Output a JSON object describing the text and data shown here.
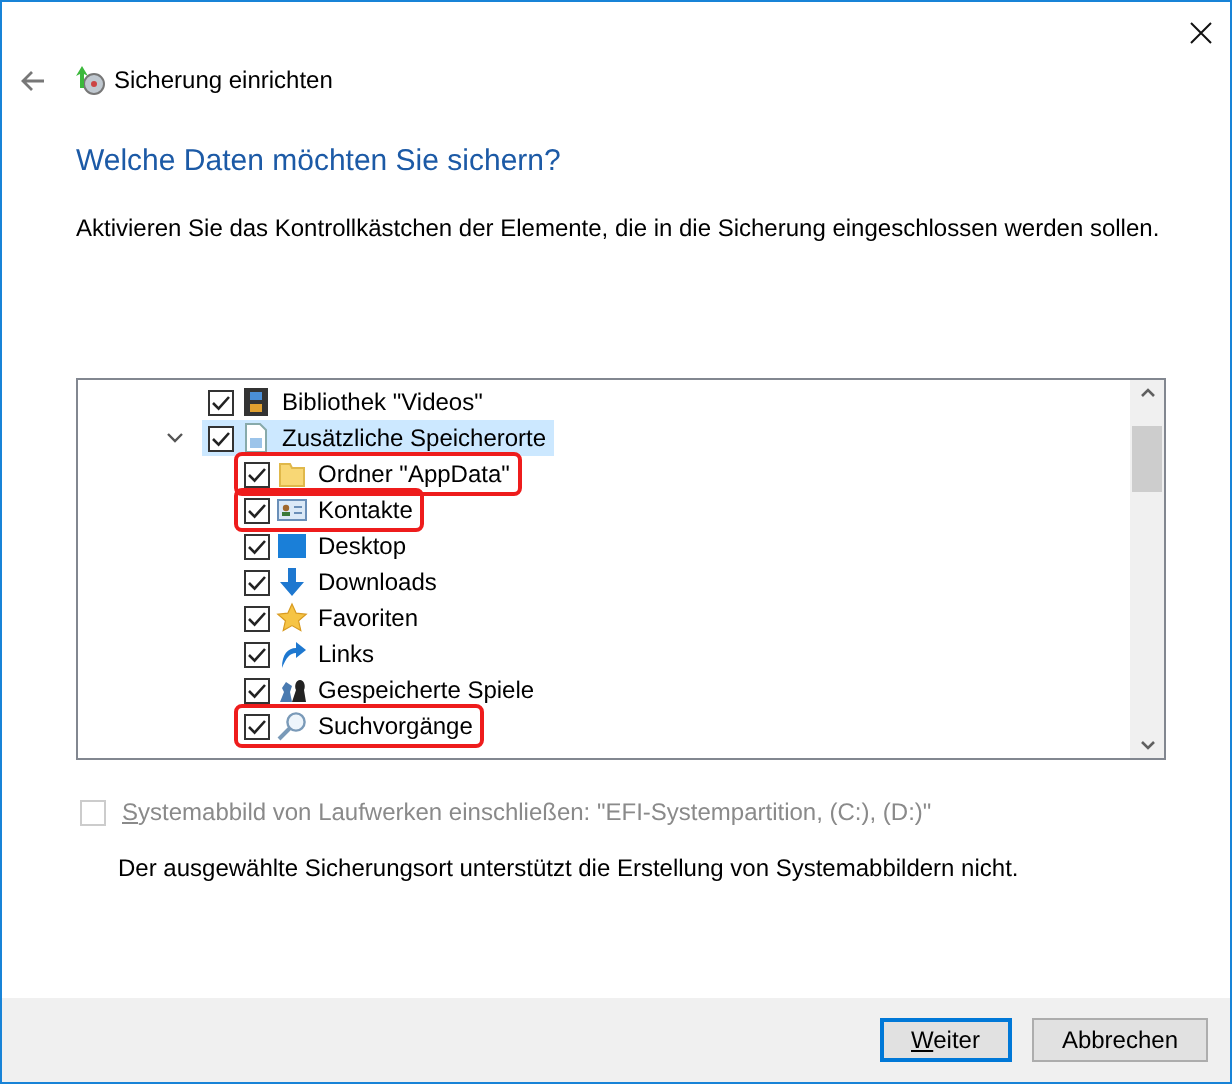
{
  "window": {
    "title": "Sicherung einrichten"
  },
  "heading": "Welche Daten möchten Sie sichern?",
  "description": "Aktivieren Sie das Kontrollkästchen der Elemente, die in die Sicherung eingeschlossen werden sollen.",
  "tree": [
    {
      "label": "Bibliothek \"Videos\"",
      "kind": "videos",
      "checked": true,
      "selected": false,
      "highlighted": false
    },
    {
      "label": "Zusätzliche Speicherorte",
      "kind": "file",
      "checked": true,
      "selected": true,
      "highlighted": false,
      "expanded": true,
      "children": [
        {
          "label": "Ordner \"AppData\"",
          "kind": "folder",
          "checked": true,
          "selected": false,
          "highlighted": true
        },
        {
          "label": "Kontakte",
          "kind": "contact",
          "checked": true,
          "selected": false,
          "highlighted": true
        },
        {
          "label": "Desktop",
          "kind": "desktop",
          "checked": true,
          "selected": false,
          "highlighted": false
        },
        {
          "label": "Downloads",
          "kind": "download",
          "checked": true,
          "selected": false,
          "highlighted": false
        },
        {
          "label": "Favoriten",
          "kind": "star",
          "checked": true,
          "selected": false,
          "highlighted": false
        },
        {
          "label": "Links",
          "kind": "link",
          "checked": true,
          "selected": false,
          "highlighted": false
        },
        {
          "label": "Gespeicherte Spiele",
          "kind": "games",
          "checked": true,
          "selected": false,
          "highlighted": false
        },
        {
          "label": "Suchvorgänge",
          "kind": "search",
          "checked": true,
          "selected": false,
          "highlighted": true
        }
      ]
    }
  ],
  "system_image": {
    "label": "Systemabbild von Laufwerken einschließen: \"EFI-Systempartition, (C:), (D:)\"",
    "mnemonic": true,
    "checked": false,
    "disabled": true
  },
  "note": "Der ausgewählte Sicherungsort unterstützt die Erstellung von Systemabbildern nicht.",
  "buttons": [
    {
      "label": "Weiter",
      "mnemonic": true,
      "default": true
    },
    {
      "label": "Abbrechen",
      "mnemonic": false,
      "default": false
    }
  ]
}
